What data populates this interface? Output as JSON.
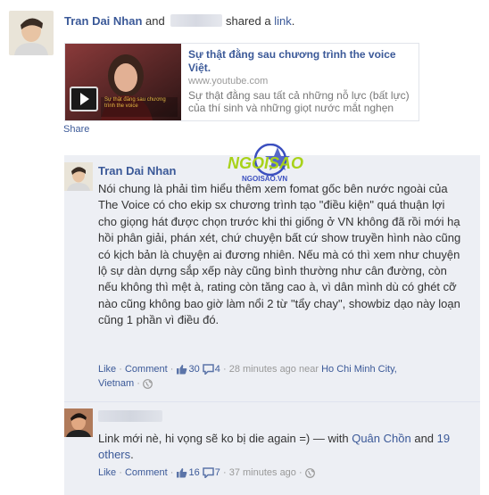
{
  "story": {
    "actor": "Tran Dai Nhan",
    "connector": "and",
    "action": "shared",
    "article": "a",
    "object": "link",
    "period": "."
  },
  "shared_link": {
    "title": "Sự thật đằng sau chương trình the voice Việt.",
    "domain": "www.youtube.com",
    "description": "Sự thật đằng sau tất cả những nỗ lực (bất lực) của thí sinh và những giọt nước mắt nghẹn",
    "thumb_overlay": "Sự thật đằng sau chương trình the voice"
  },
  "share_action": "Share",
  "logo": {
    "text_main": "NGOISAO",
    "text_sub": "NGOISAO.VN"
  },
  "comments": [
    {
      "author": "Tran Dai Nhan",
      "text": "Nói chung là phải tìm hiểu thêm xem fomat gốc bên nước ngoài của The Voice có cho ekip sx chương trình tạo \"điều kiện\" quá thuận lợi cho giọng hát được chọn trước khi thi giống ở VN không đã rồi mới hạ hồi phân giải, phán xét, chứ chuyện bất cứ show truyền hình nào cũng có kịch bản là chuyện ai đương nhiên. Nếu mà có thì xem như chuyện lộ sự dàn dựng sắp xếp này cũng bình thường như cân đường, còn nếu không thì mệt à, rating còn tăng cao à, vì dân mình dù có ghét cỡ nào cũng không bao giờ làm nổi 2 từ \"tẩy chay\", showbiz dạo này loạn cũng 1 phần vì điều đó.",
      "like": "Like",
      "comment": "Comment",
      "likes_count": "30",
      "comments_count": "4",
      "time": "28 minutes ago",
      "near": "near",
      "location": "Ho Chi Minh City, Vietnam",
      "separator": "·"
    },
    {
      "text_before": "Link mới nè, hi vọng sẽ ko bị die again =) — with",
      "tagged_person": "Quân Chồn",
      "and_word": "and",
      "others": "19 others",
      "period": ".",
      "like": "Like",
      "comment": "Comment",
      "likes_count": "16",
      "comments_count": "7",
      "time": "37 minutes ago",
      "separator": "·"
    }
  ],
  "colors": {
    "link": "#3b5998",
    "comment_bg": "#edeff4",
    "meta": "#999999",
    "logo_main": "#a8d21a",
    "logo_accent": "#3b4fbf"
  }
}
